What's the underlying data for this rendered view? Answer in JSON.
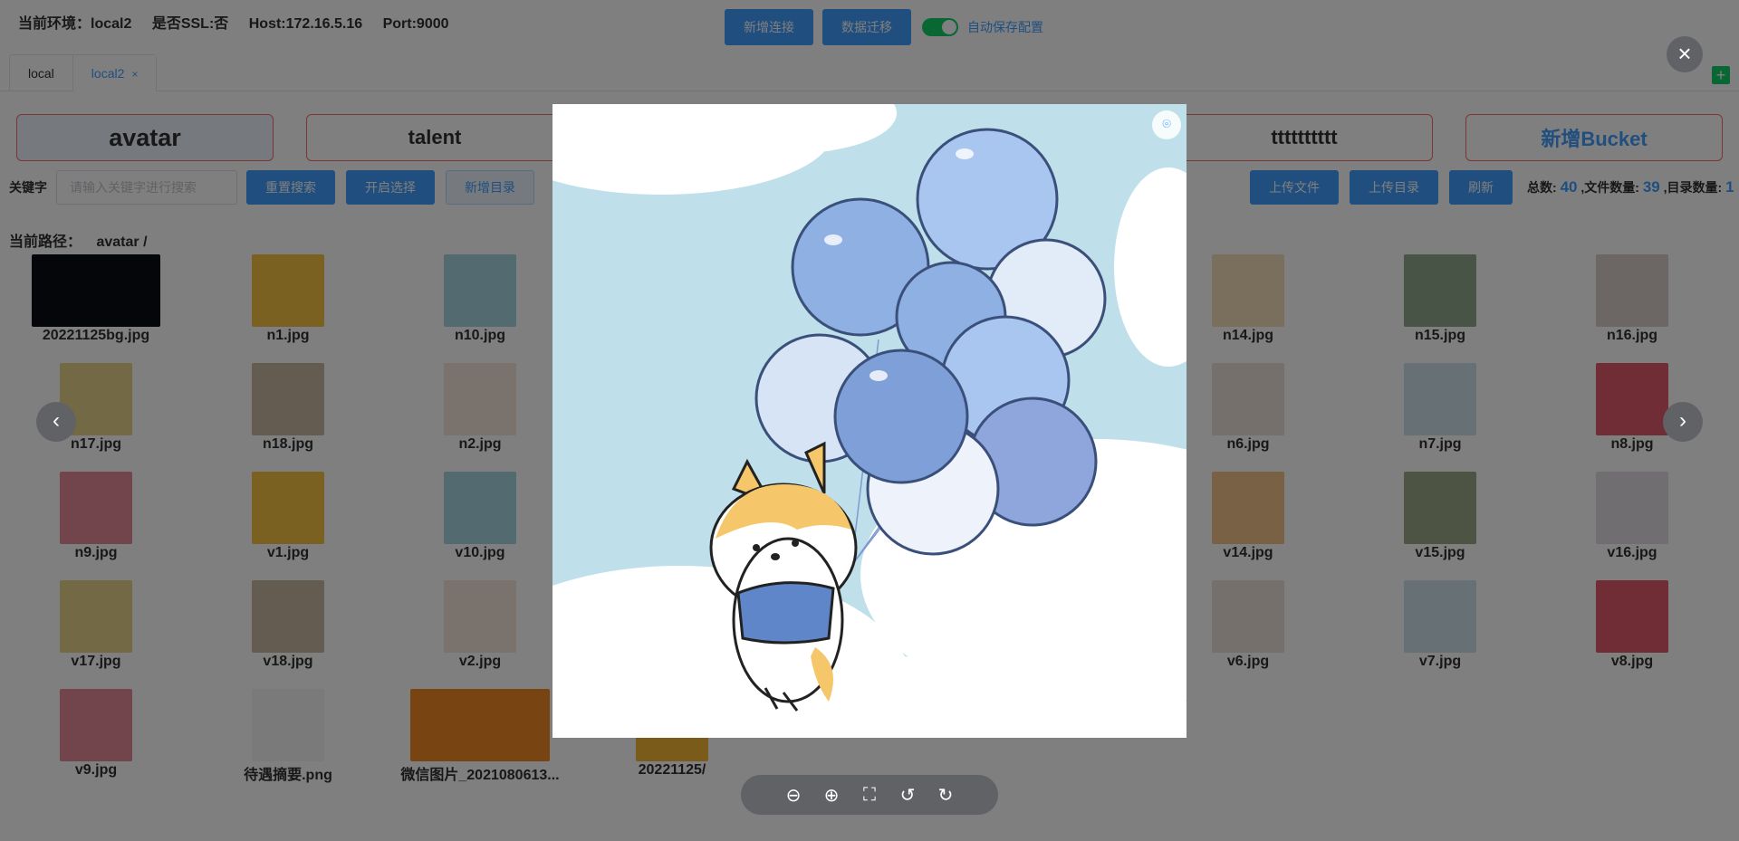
{
  "header": {
    "env": "当前环境：local2",
    "ssl": "是否SSL:否",
    "host": "Host:172.16.5.16",
    "port": "Port:9000",
    "new_connection": "新增连接",
    "data_migration": "数据迁移",
    "autosave_label": "自动保存配置",
    "autosave_on": true
  },
  "tabs": [
    {
      "label": "local",
      "active": false
    },
    {
      "label": "local2",
      "active": true,
      "close": "×"
    }
  ],
  "add_tab_icon": "+",
  "buckets": [
    {
      "label": "avatar",
      "selected": true
    },
    {
      "label": "talent"
    },
    {
      "label": "tttttttttt"
    },
    {
      "label": "新增Bucket"
    }
  ],
  "search": {
    "label": "关键字",
    "placeholder": "请输入关键字进行搜索",
    "reset": "重置搜索",
    "select": "开启选择",
    "new_dir": "新增目录"
  },
  "actions": {
    "upload_file": "上传文件",
    "upload_dir": "上传目录",
    "refresh": "刷新"
  },
  "stats": {
    "total_label": "总数:",
    "total": "40",
    "files_label": ",文件数量:",
    "files": "39",
    "dirs_label": ",目录数量:",
    "dirs": "1"
  },
  "path": {
    "label": "当前路径：",
    "value": "avatar /"
  },
  "files": [
    {
      "name": "20221125bg.jpg"
    },
    {
      "name": "n1.jpg"
    },
    {
      "name": "n10.jpg"
    },
    {
      "name": "n14.jpg"
    },
    {
      "name": "n15.jpg"
    },
    {
      "name": "n16.jpg"
    },
    {
      "name": "n17.jpg"
    },
    {
      "name": "n18.jpg"
    },
    {
      "name": "n2.jpg"
    },
    {
      "name": "n6.jpg"
    },
    {
      "name": "n7.jpg"
    },
    {
      "name": "n8.jpg"
    },
    {
      "name": "n9.jpg"
    },
    {
      "name": "v1.jpg"
    },
    {
      "name": "v10.jpg"
    },
    {
      "name": "v14.jpg"
    },
    {
      "name": "v15.jpg"
    },
    {
      "name": "v16.jpg"
    },
    {
      "name": "v17.jpg"
    },
    {
      "name": "v18.jpg"
    },
    {
      "name": "v2.jpg"
    },
    {
      "name": "v6.jpg"
    },
    {
      "name": "v7.jpg"
    },
    {
      "name": "v8.jpg"
    },
    {
      "name": "v9.jpg"
    },
    {
      "name": "待遇摘要.png"
    },
    {
      "name": "微信图片_2021080613..."
    },
    {
      "name": "20221125/"
    }
  ],
  "viewer": {
    "close_icon": "×",
    "prev_icon": "‹",
    "next_icon": "›",
    "zoom_out": "⊖",
    "zoom_in": "⊕",
    "fullscreen": "⛶",
    "rotate_left": "↺",
    "rotate_right": "↻",
    "corner_icon": "⌾"
  },
  "colors": {
    "primary": "#409eff",
    "success": "#13ce66",
    "danger": "#f56c6c",
    "sky": "#bfe0ea",
    "balloon": "#8fb0e3"
  }
}
